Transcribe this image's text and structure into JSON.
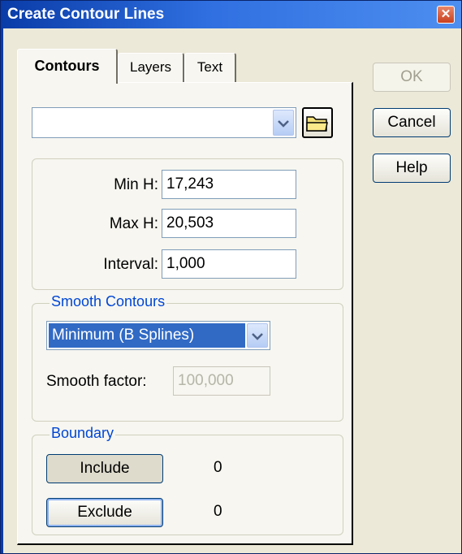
{
  "window": {
    "title": "Create Contour Lines",
    "close_icon": "close-icon"
  },
  "tabs": [
    {
      "label": "Contours",
      "active": true
    },
    {
      "label": "Layers",
      "active": false
    },
    {
      "label": "Text",
      "active": false
    }
  ],
  "source": {
    "value": "",
    "dropdown_icon": "chevron-down-icon",
    "browse_icon": "folder-icon"
  },
  "height": {
    "min_label": "Min H:",
    "min_value": "17,243",
    "max_label": "Max H:",
    "max_value": "20,503",
    "interval_label": "Interval:",
    "interval_value": "1,000"
  },
  "smooth": {
    "group_label": "Smooth Contours",
    "method": "Minimum (B Splines)",
    "factor_label": "Smooth factor:",
    "factor_value": "100,000"
  },
  "boundary": {
    "group_label": "Boundary",
    "include_label": "Include",
    "include_count": "0",
    "exclude_label": "Exclude",
    "exclude_count": "0"
  },
  "buttons": {
    "ok": "OK",
    "cancel": "Cancel",
    "help": "Help"
  },
  "colors": {
    "title_bar": "#0a3ca8",
    "group_label": "#0046d5",
    "selection": "#316ac5"
  }
}
